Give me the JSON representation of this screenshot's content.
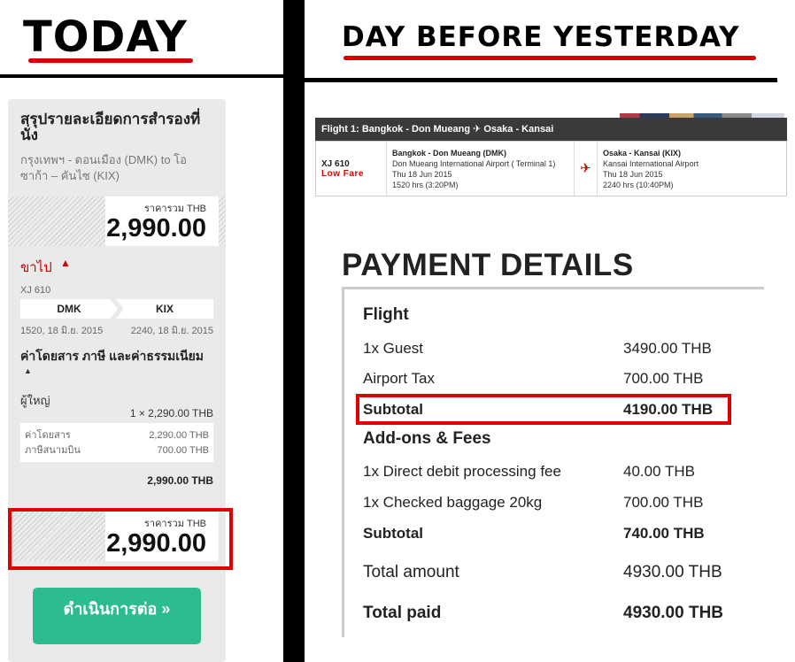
{
  "headings": {
    "today": "TODAY",
    "day_before_yesterday": "DAY BEFORE YESTERDAY"
  },
  "colors": {
    "accent_red": "#e00000",
    "continue_green": "#2bbd8f",
    "flight_bar": "#3a3a3a"
  },
  "today_panel": {
    "title": "สรุปรายละเอียดการสำรองที่นั่ง",
    "route_desc": "กรุงเทพฯ - ดอนเมือง (DMK) to โอซาก้า – คันไซ (KIX)",
    "price_label": "ราคารวม THB",
    "price_value": "2,990.00",
    "outbound_label": "ขาไป",
    "flight_code": "XJ 610",
    "origin": "DMK",
    "destination": "KIX",
    "departure": "1520, 18 มิ.ย. 2015",
    "arrival": "2240, 18 มิ.ย. 2015",
    "fare_heading": "ค่าโดยสาร ภาษี และค่าธรรมเนียม",
    "adult_label": "ผู้ใหญ่",
    "adult_qty": "1 × 2,290.00 THB",
    "fare_rows": [
      {
        "label": "ค่าโดยสาร",
        "value": "2,290.00 THB"
      },
      {
        "label": "ภาษีสนามบิน",
        "value": "700.00 THB"
      }
    ],
    "fare_total": "2,990.00 THB",
    "total_label": "ราคารวม THB",
    "total_value": "2,990.00",
    "continue_label": "ดำเนินการต่อ »"
  },
  "flight": {
    "bar_title": "Flight 1: Bangkok - Don Mueang ✈ Osaka - Kansai",
    "code": "XJ 610",
    "fare_class": "Low Fare",
    "dep_city": "Bangkok - Don Mueang (DMK)",
    "dep_airport": "Don Mueang International Airport ( Terminal 1)",
    "dep_date": "Thu 18 Jun 2015",
    "dep_time": "1520 hrs (3:20PM)",
    "arr_city": "Osaka - Kansai (KIX)",
    "arr_airport": "Kansai International Airport",
    "arr_date": "Thu 18 Jun 2015",
    "arr_time": "2240 hrs (10:40PM)"
  },
  "payment": {
    "title": "PAYMENT DETAILS",
    "flight_heading": "Flight",
    "guest_label": "1x Guest",
    "guest_value": "3490.00 THB",
    "tax_label": "Airport Tax",
    "tax_value": "700.00 THB",
    "flight_subtotal_label": "Subtotal",
    "flight_subtotal_value": "4190.00 THB",
    "addons_heading": "Add-ons & Fees",
    "debit_label": "1x Direct debit processing fee",
    "debit_value": "40.00 THB",
    "baggage_label": "1x Checked baggage 20kg",
    "baggage_value": "700.00 THB",
    "addons_subtotal_label": "Subtotal",
    "addons_subtotal_value": "740.00 THB",
    "total_amount_label": "Total amount",
    "total_amount_value": "4930.00 THB",
    "total_paid_label": "Total paid",
    "total_paid_value": "4930.00 THB"
  }
}
